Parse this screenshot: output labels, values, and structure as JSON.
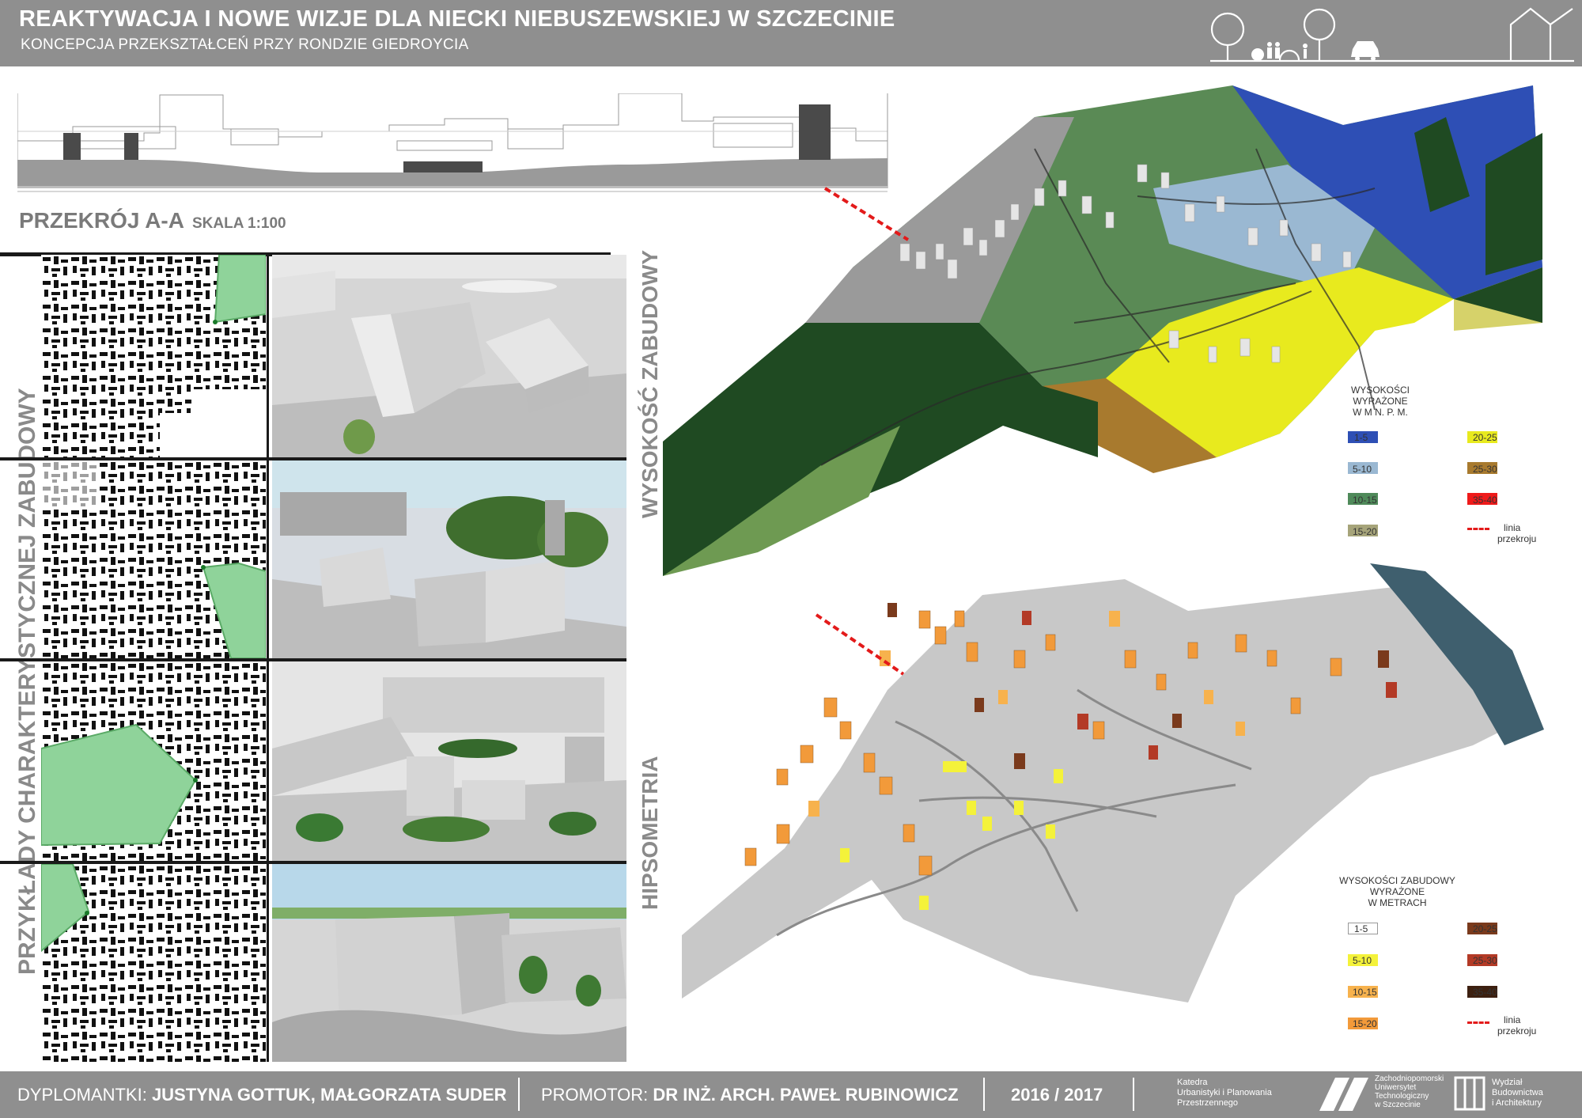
{
  "header": {
    "title": "REAKTYWACJA I NOWE WIZJE DLA NIECKI NIEBUSZEWSKIEJ W SZCZECINIE",
    "subtitle": "KONCEPCJA PRZEKSZTAŁCEŃ PRZY RONDZIE GIEDROYCIA"
  },
  "section": {
    "title": "PRZEKRÓJ A-A",
    "scale": "SKALA 1:100"
  },
  "side_labels": {
    "examples": "PRZYKŁADY CHARAKTERYSTYCZNEJ ZABUDOWY",
    "heights": "WYSOKOŚĆ ZABUDOWY",
    "hypsometry": "HIPSOMETRIA"
  },
  "legend_hypso": {
    "title": [
      "WYSOKOŚCI",
      "WYRAŻONE",
      "W M N. P. M."
    ],
    "items": [
      {
        "label": "1-5",
        "color": "#2e4fb5"
      },
      {
        "label": "20-25",
        "color": "#e8ea1e"
      },
      {
        "label": "5-10",
        "color": "#9ab8d2"
      },
      {
        "label": "25-30",
        "color": "#a87a2e"
      },
      {
        "label": "10-15",
        "color": "#4f8a5a"
      },
      {
        "label": "35-40",
        "color": "#ef1a1a"
      },
      {
        "label": "15-20",
        "color": "#a6a47a"
      }
    ],
    "line_label": [
      "linia",
      "przekroju"
    ]
  },
  "legend_heights": {
    "title": [
      "WYSOKOŚCI ZABUDOWY",
      "WYRAŻONE",
      "W METRACH"
    ],
    "items": [
      {
        "label": "1-5",
        "color": "#ffffff"
      },
      {
        "label": "20-25",
        "color": "#7a3a1c"
      },
      {
        "label": "5-10",
        "color": "#f4f23a"
      },
      {
        "label": "25-30",
        "color": "#b33a26"
      },
      {
        "label": "10-15",
        "color": "#f7b24d"
      },
      {
        "label": "35-40",
        "color": "#3d2010"
      },
      {
        "label": "15-20",
        "color": "#f29a3a"
      }
    ],
    "line_label": [
      "linia",
      "przekroju"
    ]
  },
  "footer": {
    "authors_label": "DYPLOMANTKI:",
    "authors": "JUSTYNA GOTTUK, MAŁGORZATA SUDER",
    "promoter_label": "PROMOTOR:",
    "promoter": "DR INŻ. ARCH. PAWEŁ RUBINOWICZ",
    "year": "2016 / 2017",
    "dept": [
      "Katedra",
      "Urbanistyki i Planowania",
      "Przestrzennego"
    ],
    "uni": [
      "Zachodniopomorski",
      "Uniwersytet",
      "Technologiczny",
      "w Szczecinie"
    ],
    "faculty": [
      "Wydział",
      "Budownictwa",
      "i Architektury"
    ]
  },
  "colors": {
    "header": "#8f8f8f",
    "green_area": "#8fd39a",
    "section_line": "#e06a1a"
  }
}
